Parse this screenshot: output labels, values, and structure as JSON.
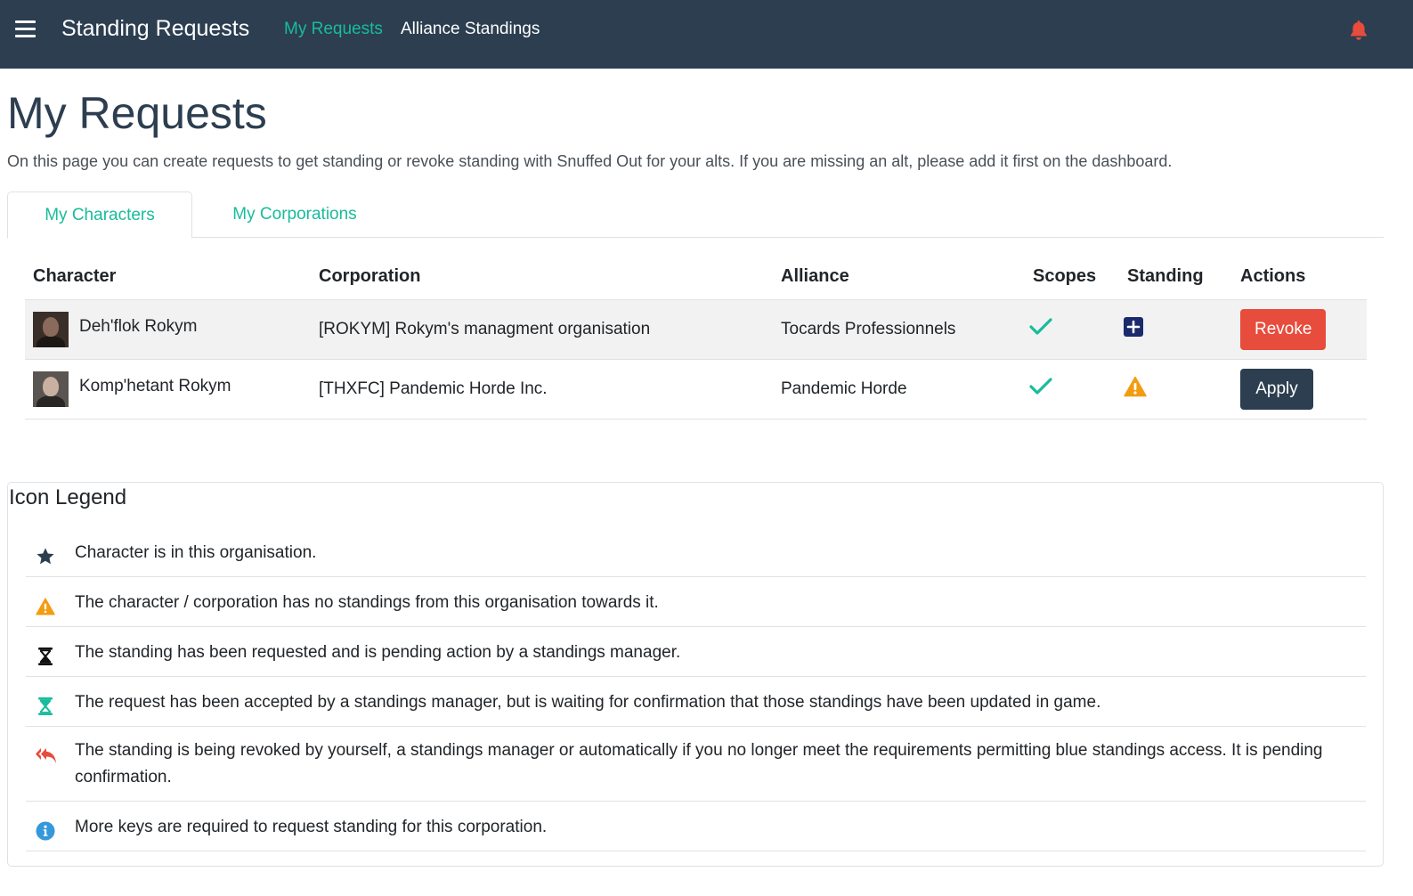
{
  "navbar": {
    "brand": "Standing Requests",
    "links": [
      {
        "label": "My Requests",
        "active": true
      },
      {
        "label": "Alliance Standings",
        "active": false
      }
    ],
    "icons": {
      "menu": "hamburger-icon",
      "notifications": "bell-icon"
    },
    "colors": {
      "background": "#2c3e50",
      "accent": "#18bc9c",
      "bell": "#e74c3c"
    }
  },
  "page": {
    "title": "My Requests",
    "intro": "On this page you can create requests to get standing or revoke standing with Snuffed Out for your alts. If you are missing an alt, please add it first on the dashboard."
  },
  "tabs": [
    {
      "label": "My Characters",
      "active": true
    },
    {
      "label": "My Corporations",
      "active": false
    }
  ],
  "table": {
    "headers": [
      "Character",
      "Corporation",
      "Alliance",
      "Scopes",
      "Standing",
      "Actions"
    ],
    "rows": [
      {
        "character": "Deh'flok Rokym",
        "corporation": "[ROKYM] Rokym's managment organisation",
        "alliance": "Tocards Professionnels",
        "scopes_icon": "check-icon",
        "standing_icon": "plus-square-icon",
        "action": "Revoke"
      },
      {
        "character": "Komp'hetant Rokym",
        "corporation": "[THXFC] Pandemic Horde Inc.",
        "alliance": "Pandemic Horde",
        "scopes_icon": "check-icon",
        "standing_icon": "warning-icon",
        "action": "Apply"
      }
    ]
  },
  "legend": {
    "title": "Icon Legend",
    "items": [
      {
        "icon": "star-icon",
        "text": "Character is in this organisation."
      },
      {
        "icon": "warning-icon",
        "text": "The character / corporation has no standings from this organisation towards it."
      },
      {
        "icon": "hourglass-icon",
        "text": "The standing has been requested and is pending action by a standings manager."
      },
      {
        "icon": "hourglass-teal-icon",
        "text": "The request has been accepted by a standings manager, but is waiting for confirmation that those standings have been updated in game."
      },
      {
        "icon": "reply-all-icon",
        "text": "The standing is being revoked by yourself, a standings manager or automatically if you no longer meet the requirements permitting blue standings access. It is pending confirmation."
      },
      {
        "icon": "info-icon",
        "text": "More keys are required to request standing for this corporation."
      }
    ]
  },
  "colors": {
    "success": "#18bc9c",
    "danger": "#e74c3c",
    "warning": "#f39c12",
    "primary": "#2c3e50",
    "info": "#3498db"
  }
}
